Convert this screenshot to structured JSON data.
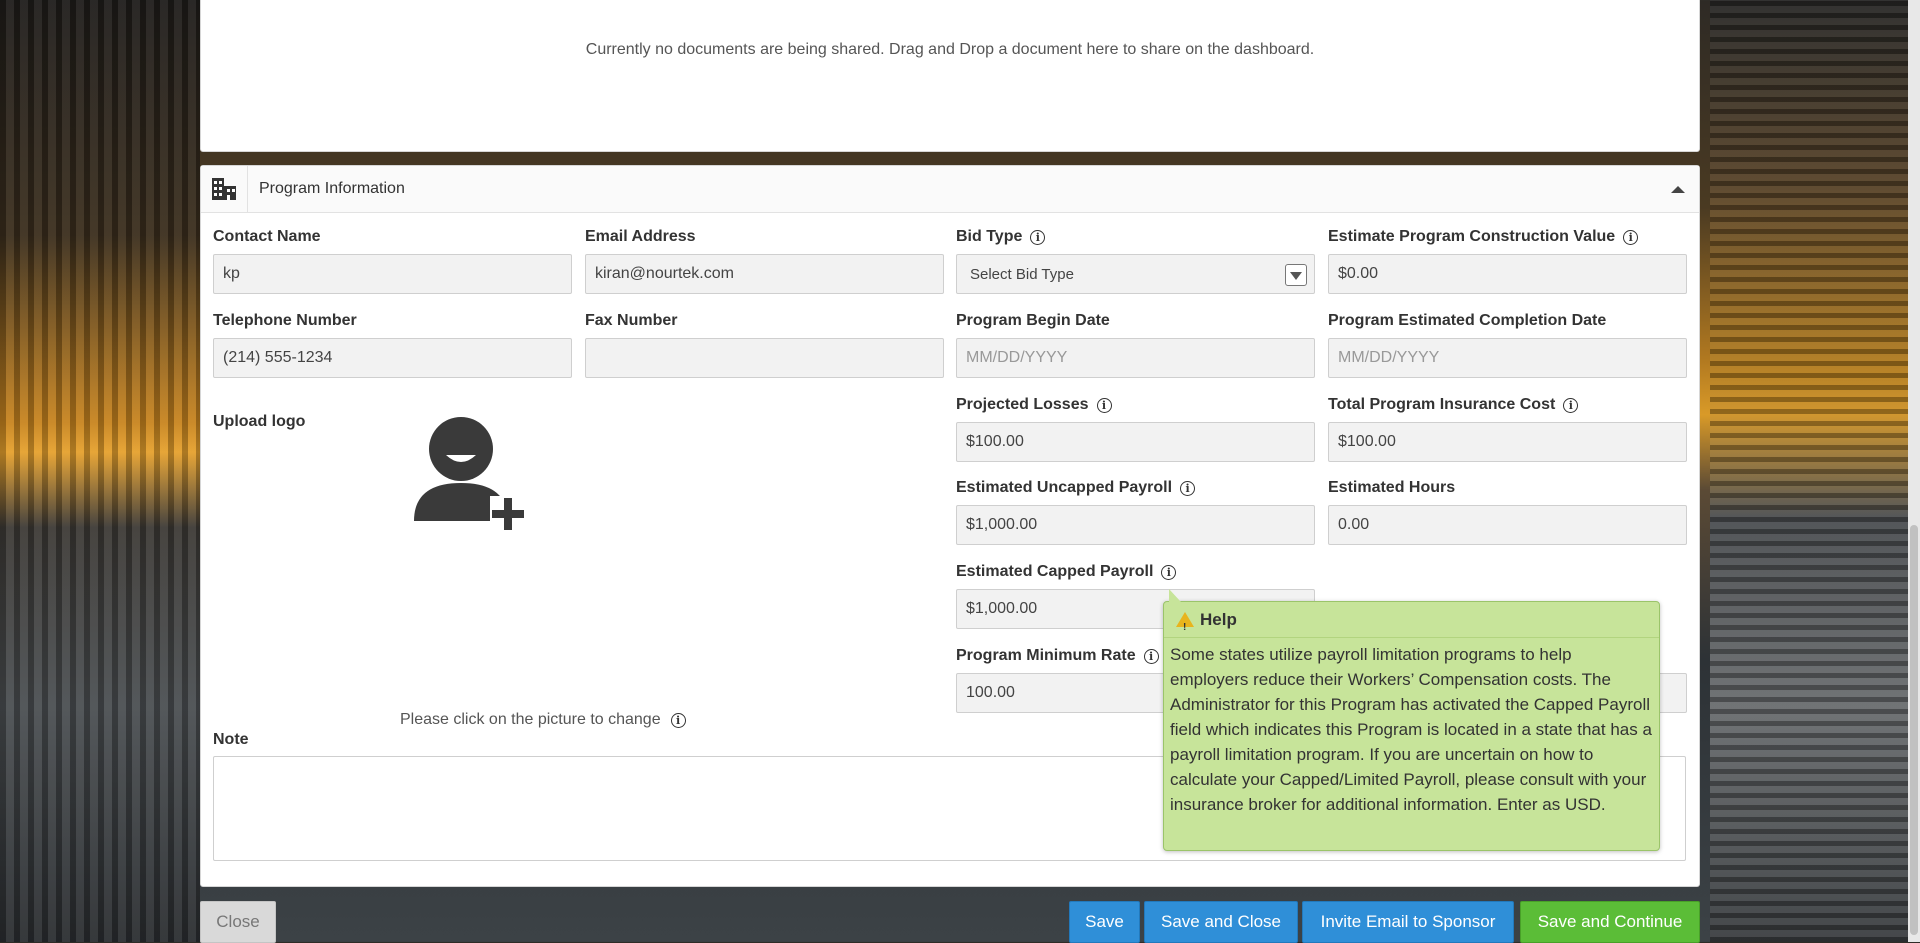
{
  "documents": {
    "empty_message": "Currently no documents are being shared. Drag and Drop a document here to share on the dashboard."
  },
  "program_panel": {
    "title": "Program Information",
    "icon": "building-icon",
    "collapse_icon": "caret-up-icon"
  },
  "fields": {
    "contact_name": {
      "label": "Contact Name",
      "value": "kp"
    },
    "email": {
      "label": "Email Address",
      "value": "kiran@nourtek.com"
    },
    "bid_type": {
      "label": "Bid Type",
      "value": "Select Bid Type"
    },
    "construction_value": {
      "label": "Estimate Program Construction Value",
      "value": "$0.00"
    },
    "telephone": {
      "label": "Telephone Number",
      "value": "(214) 555-1234"
    },
    "fax": {
      "label": "Fax Number",
      "value": ""
    },
    "begin_date": {
      "label": "Program Begin Date",
      "placeholder": "MM/DD/YYYY"
    },
    "completion_date": {
      "label": "Program Estimated Completion Date",
      "placeholder": "MM/DD/YYYY"
    },
    "projected_losses": {
      "label": "Projected Losses",
      "value": "$100.00"
    },
    "insurance_cost": {
      "label": "Total Program Insurance Cost",
      "value": "$100.00"
    },
    "uncapped_payroll": {
      "label": "Estimated Uncapped Payroll",
      "value": "$1,000.00"
    },
    "estimated_hours": {
      "label": "Estimated Hours",
      "value": "0.00"
    },
    "capped_payroll": {
      "label": "Estimated Capped Payroll",
      "value": "$1,000.00"
    },
    "minimum_rate": {
      "label": "Program Minimum Rate",
      "value": "100.00"
    },
    "note": {
      "label": "Note",
      "value": ""
    }
  },
  "logo": {
    "label": "Upload logo",
    "hint": "Please click on the picture to change",
    "icon": "add-user-icon"
  },
  "help_popup": {
    "title": "Help",
    "body": "Some states utilize payroll limitation programs to help employers reduce their Workers’ Compensation costs. The Administrator for this Program has activated the Capped Payroll field which indicates this Program is located in a state that has a payroll limitation program. If you are uncertain on how to calculate your Capped/Limited Payroll, please consult with your insurance broker for additional information. Enter as USD."
  },
  "buttons": {
    "close": "Close",
    "save": "Save",
    "save_close": "Save and Close",
    "invite": "Invite Email to Sponsor",
    "save_continue": "Save and Continue"
  }
}
